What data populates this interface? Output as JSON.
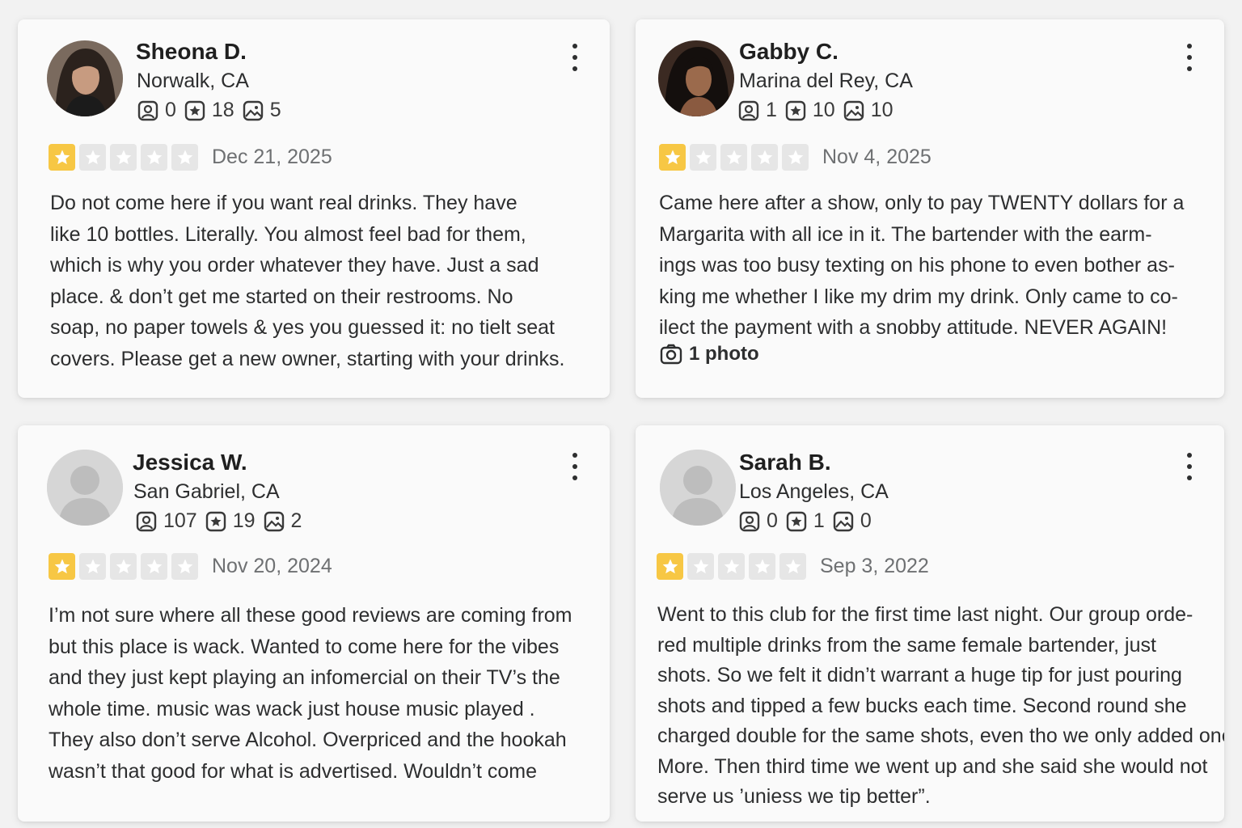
{
  "reviews": [
    {
      "name": "Sheona D.",
      "location": "Norwalk, CA",
      "stats": {
        "friends": "0",
        "reviews": "18",
        "photos": "5"
      },
      "rating": 1,
      "date": "Dec 21, 2025",
      "lines": [
        "Do not come here if you want real drinks. They have",
        "like 10 bottles. Literally. You almost feel bad for them,",
        "which is why you order whatever they have. Just a sad",
        "place. & don’t get me started on their restrooms. No",
        "soap, no paper towels & yes you guessed it: no tielt seat",
        "covers. Please get a new owner, starting with your drinks."
      ],
      "photo_link": ""
    },
    {
      "name": "Gabby C.",
      "location": "Marina del Rey, CA",
      "stats": {
        "friends": "1",
        "reviews": "10",
        "photos": "10"
      },
      "rating": 1,
      "date": "Nov 4, 2025",
      "lines": [
        "Came here after a show, only to pay TWENTY dollars for a",
        "Margarita with all ice in it. The bartender with the earm-",
        "ings was too busy texting on his phone to even bother as-",
        "king me whether I like my drim my drink. Only came to co-",
        "ilect the payment with a snobby attitude. NEVER AGAIN!"
      ],
      "photo_link": "1 photo"
    },
    {
      "name": "Jessica W.",
      "location": "San Gabriel, CA",
      "stats": {
        "friends": "107",
        "reviews": "19",
        "photos": "2"
      },
      "rating": 1,
      "date": "Nov 20, 2024",
      "lines": [
        "I’m not sure where all these good reviews are coming from",
        "but this place is wack. Wanted to come here for the vibes",
        "and they just kept playing an infomercial on their TV’s the",
        "whole time. music was wack just house music played .",
        "They also don’t serve Alcohol. Overpriced and the hookah",
        "wasn’t that good for what is advertised. Wouldn’t come"
      ],
      "photo_link": ""
    },
    {
      "name": "Sarah B.",
      "location": "Los Angeles, CA",
      "stats": {
        "friends": "0",
        "reviews": "1",
        "photos": "0"
      },
      "rating": 1,
      "date": "Sep 3, 2022",
      "lines": [
        "Went to this club for the first time last night. Our group orde-",
        "red multiple drinks from the same female bartender, just",
        "shots. So we felt it didn’t warrant a huge tip for just pouring",
        "shots and tipped a few bucks each time. Second round she",
        "charged double for the same shots, even tho we only added one",
        "More. Then third time we went up and she said she would not",
        "serve us ’uniess we tip better”."
      ],
      "photo_link": ""
    }
  ],
  "colors": {
    "star_on": "#f7c744",
    "star_off": "#e6e6e6",
    "card_bg": "#fafafa",
    "page_bg": "#f2f2f2"
  }
}
